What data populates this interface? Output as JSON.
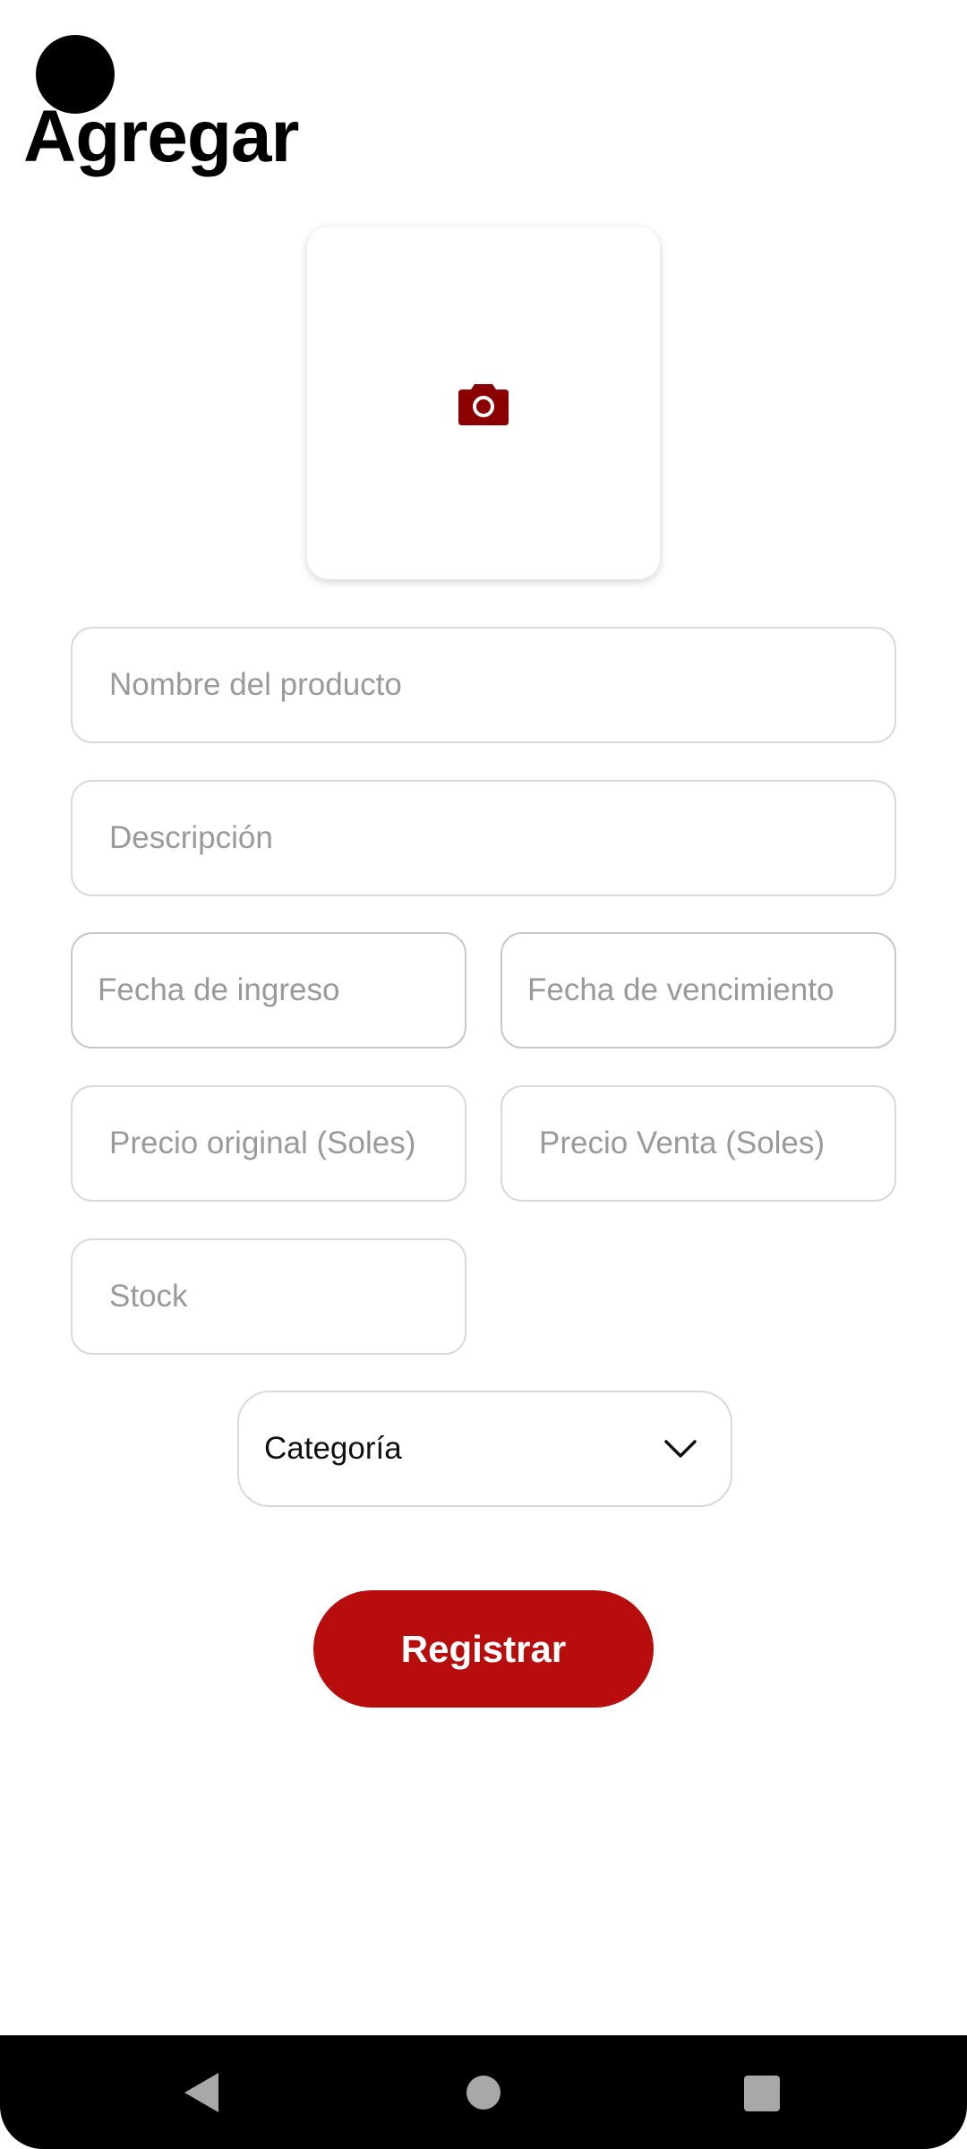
{
  "header": {
    "title": "Agregar",
    "back_icon": "back-circle-icon"
  },
  "photo": {
    "icon": "camera-icon",
    "icon_color": "#8b0000"
  },
  "form": {
    "product_name_placeholder": "Nombre del producto",
    "description_placeholder": "Descripción",
    "entry_date_placeholder": "Fecha de ingreso",
    "expiry_date_placeholder": "Fecha de vencimiento",
    "original_price_placeholder": "Precio original (Soles)",
    "sale_price_placeholder": "Precio Venta (Soles)",
    "stock_placeholder": "Stock",
    "category_selected": "Categoría",
    "category_icon": "chevron-down-icon"
  },
  "actions": {
    "register_label": "Registrar",
    "accent_color": "#b80d0d"
  },
  "system_nav": {
    "back": "triangle-back-icon",
    "home": "circle-home-icon",
    "recents": "square-recents-icon"
  }
}
